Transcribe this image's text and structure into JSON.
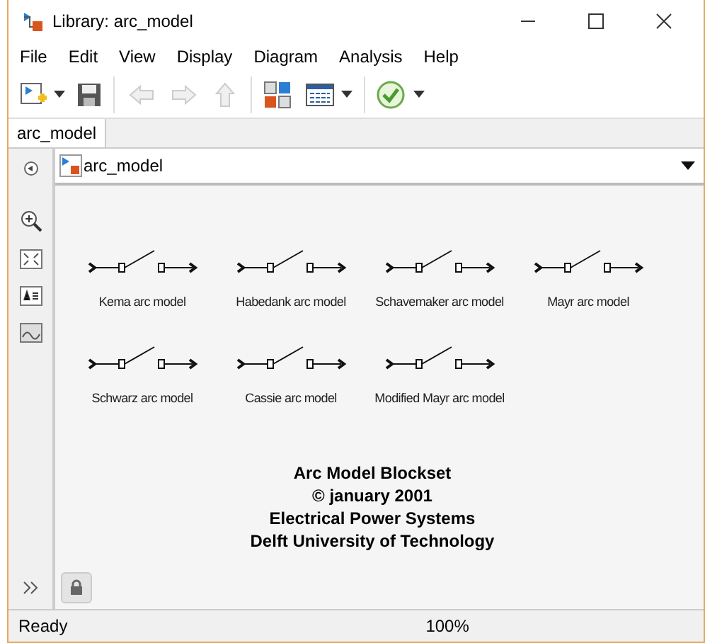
{
  "window": {
    "title": "Library: arc_model"
  },
  "menu": [
    "File",
    "Edit",
    "View",
    "Display",
    "Diagram",
    "Analysis",
    "Help"
  ],
  "tabs": [
    {
      "label": "arc_model",
      "selected": true
    }
  ],
  "address": "arc_model",
  "blocks": [
    {
      "label": "Kema arc model"
    },
    {
      "label": "Habedank arc model"
    },
    {
      "label": "Schavemaker arc model"
    },
    {
      "label": "Mayr arc model"
    },
    {
      "label": "Schwarz arc model"
    },
    {
      "label": "Cassie arc model"
    },
    {
      "label": "Modified Mayr arc model"
    }
  ],
  "credits": [
    "Arc Model Blockset",
    "© january 2001",
    "Electrical Power Systems",
    "Delft University of Technology"
  ],
  "status_bar": {
    "state": "Ready",
    "zoom": "100%"
  }
}
